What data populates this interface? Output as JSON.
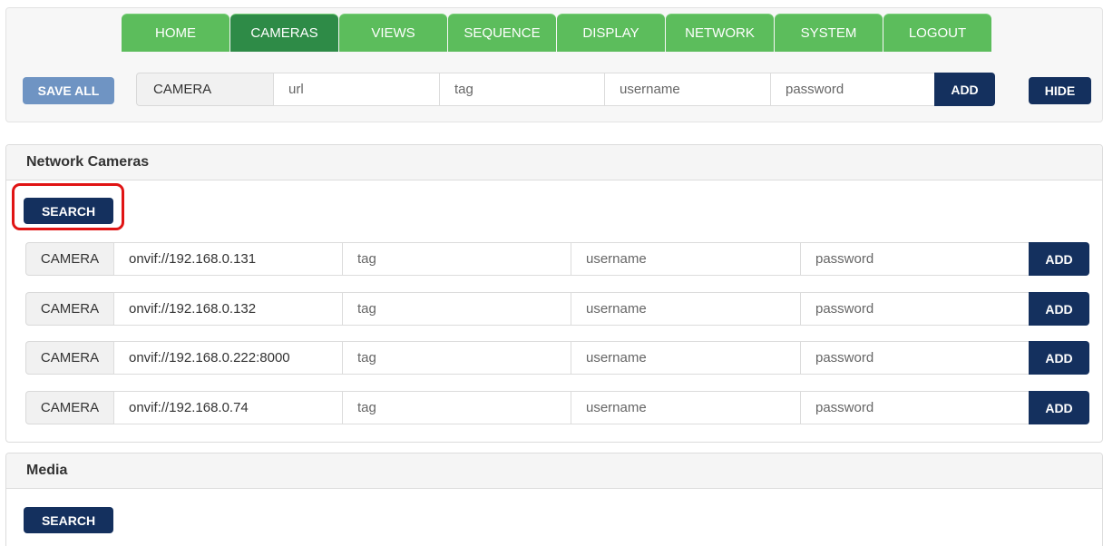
{
  "nav": {
    "tabs": [
      {
        "label": "HOME",
        "active": false
      },
      {
        "label": "CAMERAS",
        "active": true
      },
      {
        "label": "VIEWS",
        "active": false
      },
      {
        "label": "SEQUENCE",
        "active": false
      },
      {
        "label": "DISPLAY",
        "active": false
      },
      {
        "label": "NETWORK",
        "active": false
      },
      {
        "label": "SYSTEM",
        "active": false
      },
      {
        "label": "LOGOUT",
        "active": false
      }
    ]
  },
  "toolbar": {
    "save_all_label": "SAVE ALL",
    "camera_label": "CAMERA",
    "url_placeholder": "url",
    "tag_placeholder": "tag",
    "username_placeholder": "username",
    "password_placeholder": "password",
    "add_label": "ADD",
    "hide_label": "HIDE"
  },
  "network_cameras": {
    "title": "Network Cameras",
    "search_label": "SEARCH",
    "rows": [
      {
        "label": "CAMERA",
        "url": "onvif://192.168.0.131",
        "tag": "tag",
        "username": "username",
        "password": "password",
        "add": "ADD"
      },
      {
        "label": "CAMERA",
        "url": "onvif://192.168.0.132",
        "tag": "tag",
        "username": "username",
        "password": "password",
        "add": "ADD"
      },
      {
        "label": "CAMERA",
        "url": "onvif://192.168.0.222:8000",
        "tag": "tag",
        "username": "username",
        "password": "password",
        "add": "ADD"
      },
      {
        "label": "CAMERA",
        "url": "onvif://192.168.0.74",
        "tag": "tag",
        "username": "username",
        "password": "password",
        "add": "ADD"
      }
    ]
  },
  "media": {
    "title": "Media",
    "search_label": "SEARCH"
  },
  "colors": {
    "tab_green": "#5cbd5c",
    "tab_active": "#2e8b47",
    "button_navy": "#14305e",
    "save_all_blue": "#6f94c3",
    "highlight_red": "#e01414"
  }
}
